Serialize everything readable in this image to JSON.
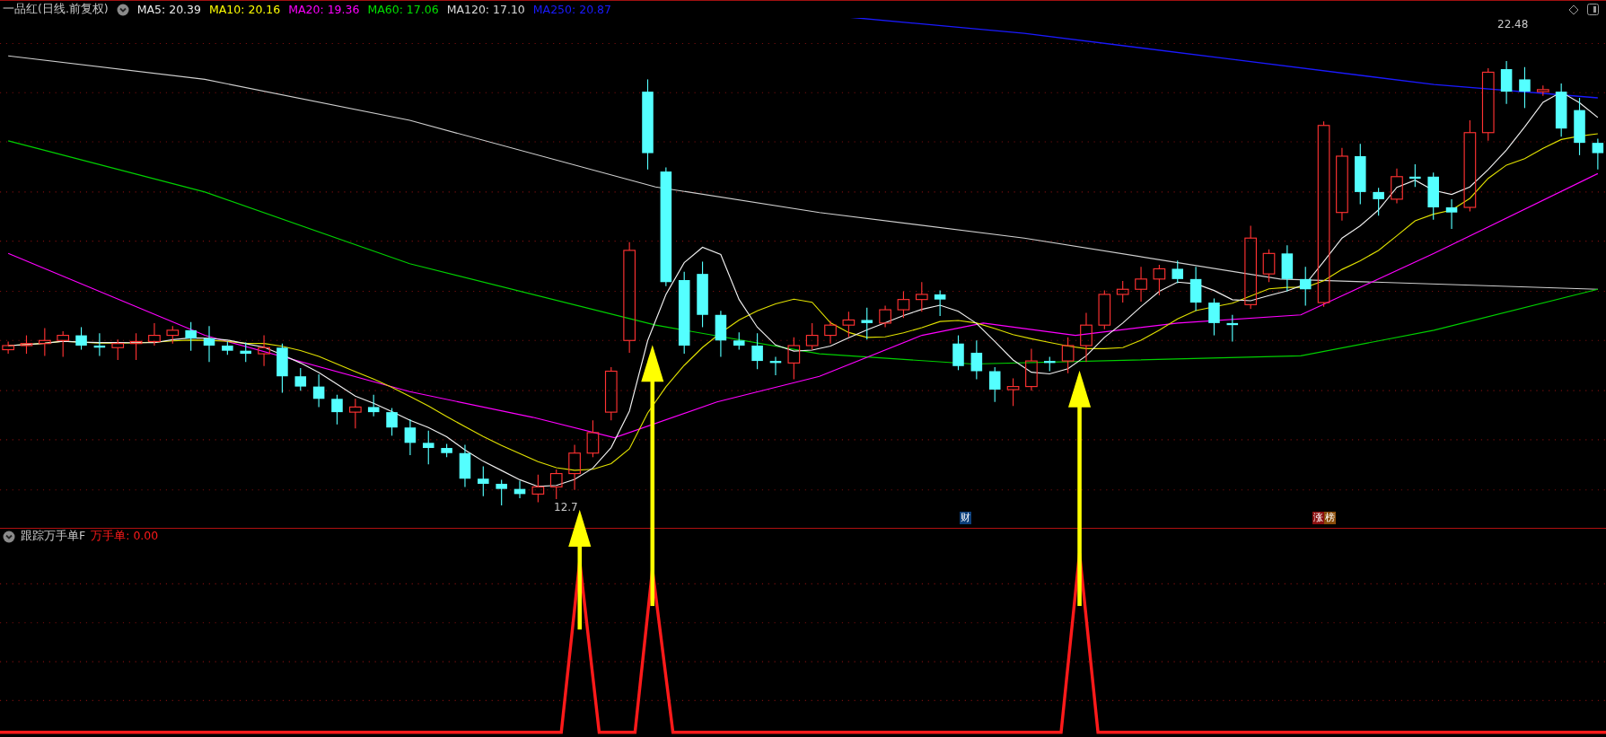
{
  "header": {
    "title": "一品红(日线.前复权)",
    "indicators": [
      {
        "label": "MA5: 20.39",
        "color": "#e8e8e8"
      },
      {
        "label": "MA10: 20.16",
        "color": "#ffff00"
      },
      {
        "label": "MA20: 19.36",
        "color": "#ff00ff"
      },
      {
        "label": "MA60: 17.06",
        "color": "#00e000"
      },
      {
        "label": "MA120: 17.10",
        "color": "#d8d8d8"
      },
      {
        "label": "MA250: 20.87",
        "color": "#1a1aff"
      }
    ]
  },
  "main_chart": {
    "high_label": "22.48",
    "low_label": "12.7",
    "badges": [
      {
        "text": "财",
        "color": "#0c3f7a"
      },
      {
        "text": "涨",
        "color": "#8a0f0f"
      },
      {
        "text": "榜",
        "color": "#8a4d0a"
      }
    ]
  },
  "sub_panel": {
    "title": "跟踪万手单F",
    "indicator": {
      "label": "万手单: 0.00",
      "color": "#ff1a1a"
    }
  }
}
